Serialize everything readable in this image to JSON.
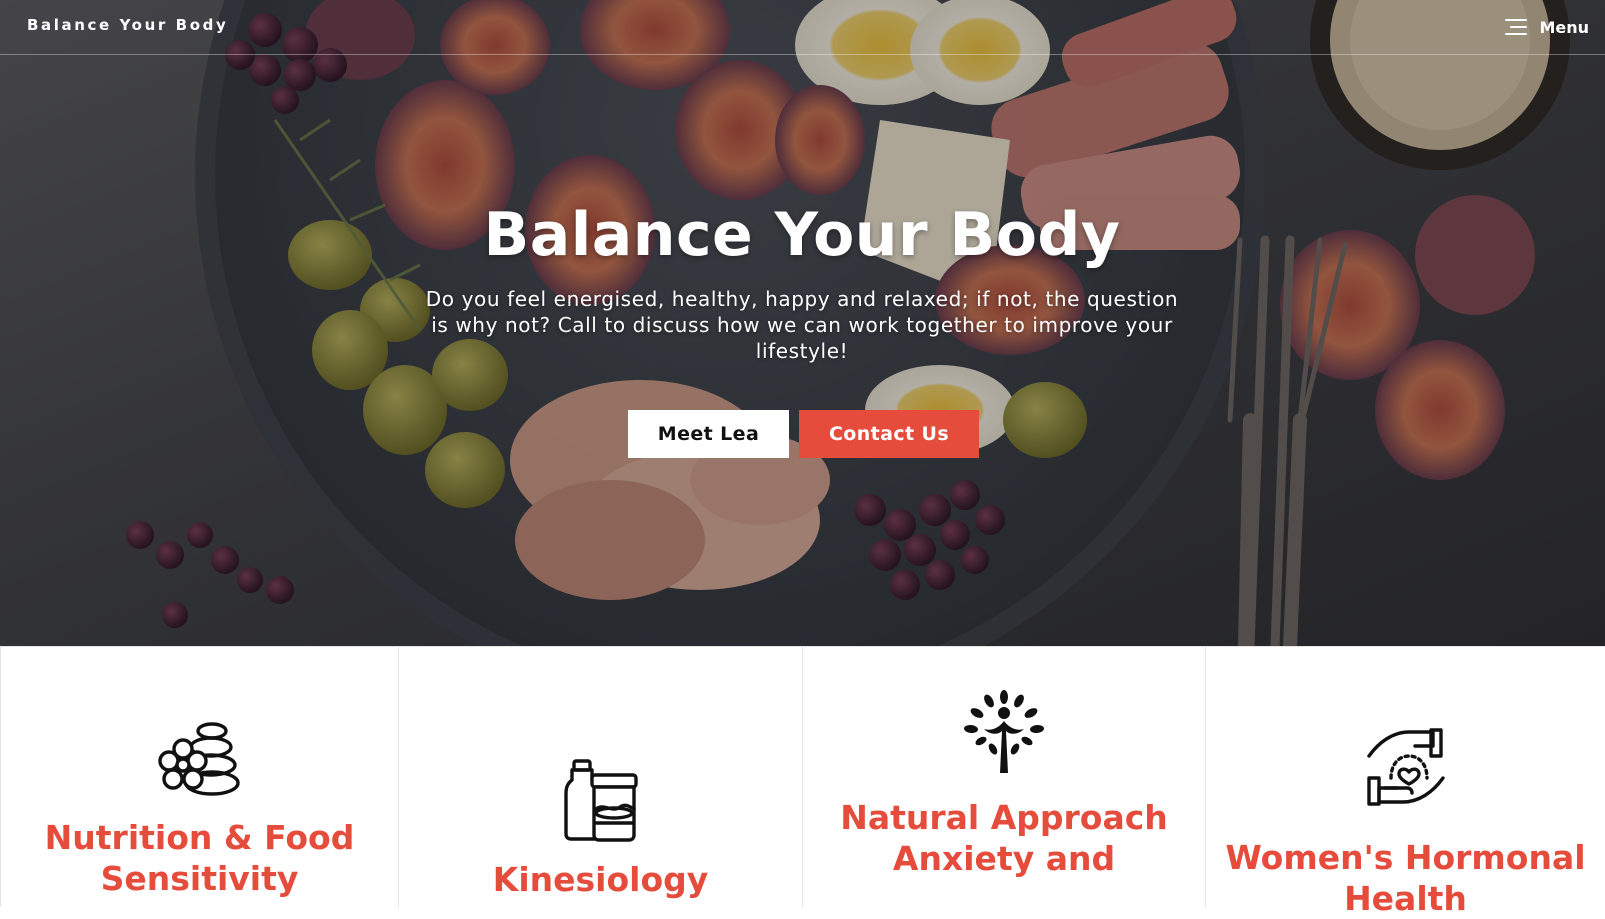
{
  "header": {
    "site_title": "Balance Your Body",
    "menu_label": "Menu",
    "menu_icon": "hamburger-icon"
  },
  "hero": {
    "heading": "Balance Your Body",
    "subtitle": "Do you feel energised, healthy, happy and relaxed; if not, the question is why not? Call to discuss how we can work together to improve your lifestyle!",
    "buttons": [
      {
        "label": "Meet Lea",
        "style": "light"
      },
      {
        "label": "Contact Us",
        "style": "accent"
      }
    ],
    "background_icon": "food-platter-photo"
  },
  "services": [
    {
      "title": "Nutrition & Food Sensitivity",
      "icon": "spa-stones-flower-icon"
    },
    {
      "title": "Kinesiology",
      "icon": "jars-bottle-icon"
    },
    {
      "title": "Natural Approach Anxiety and",
      "icon": "tree-person-icon"
    },
    {
      "title": "Women's Hormonal Health",
      "icon": "hands-heart-icon"
    }
  ],
  "colors": {
    "accent": "#e64c3c",
    "text_light": "#ffffff",
    "button_light_bg": "#ffffff",
    "button_light_text": "#111111"
  }
}
